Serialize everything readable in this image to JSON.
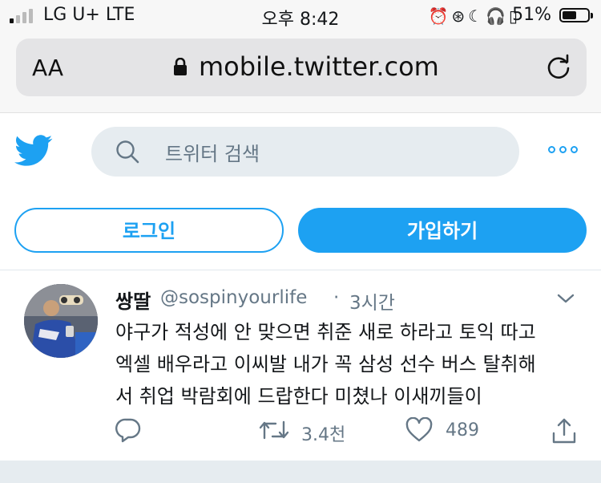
{
  "status_bar": {
    "carrier": "LG U+ LTE",
    "time": "오후 8:42",
    "battery": "51%",
    "battery_level": 0.51
  },
  "browser": {
    "text_size_label": "AA",
    "url": "mobile.twitter.com"
  },
  "header": {
    "search_placeholder": "트위터 검색"
  },
  "auth": {
    "login_label": "로그인",
    "signup_label": "가입하기"
  },
  "tweet": {
    "name": "쌍딸",
    "handle": "@sospinyourlife",
    "separator": "·",
    "time": "3시간",
    "text_lines": [
      "야구가 적성에 안 맞으면 취준 새로 하라고 토익 따고",
      "엑셀 배우라고 이씨발 내가 꼭 삼성 선수 버스 탈취해",
      "서 취업 박람회에 드랍한다 미쳤나 이새끼들이"
    ],
    "retweets": "3.4천",
    "likes": "489"
  },
  "colors": {
    "twitter_blue": "#1da1f2",
    "secondary_text": "#657786",
    "search_bg": "#e6ecf0"
  }
}
